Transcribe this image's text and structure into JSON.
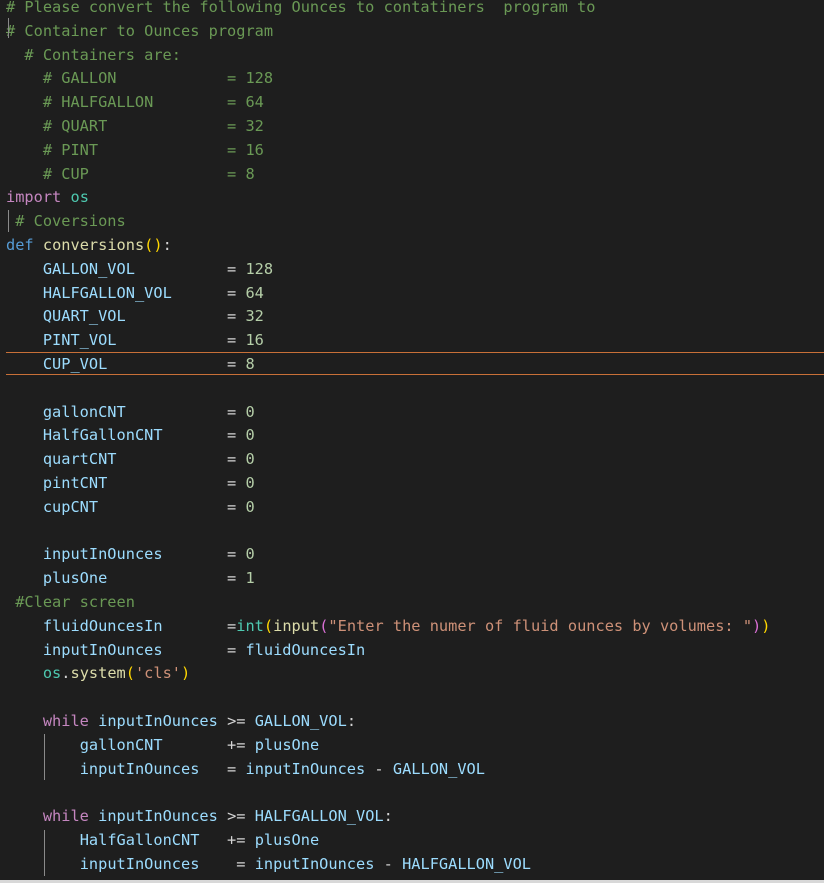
{
  "editor": {
    "lines": [
      [
        {
          "t": "# Please convert the following Ounces to contatiners  program to",
          "c": "cm"
        }
      ],
      [
        {
          "t": "# Container to Ounces program",
          "c": "cm"
        }
      ],
      [
        {
          "t": "  # Containers are:",
          "c": "cm"
        }
      ],
      [
        {
          "t": "    # GALLON            = 128",
          "c": "cm"
        }
      ],
      [
        {
          "t": "    # HALFGALLON        = 64",
          "c": "cm"
        }
      ],
      [
        {
          "t": "    # QUART             = 32",
          "c": "cm"
        }
      ],
      [
        {
          "t": "    # PINT              = 16",
          "c": "cm"
        }
      ],
      [
        {
          "t": "    # CUP               = 8",
          "c": "cm"
        }
      ],
      [
        {
          "t": "import",
          "c": "kw"
        },
        {
          "t": " ",
          "c": "op"
        },
        {
          "t": "os",
          "c": "bt"
        }
      ],
      [
        {
          "t": " # Coversions",
          "c": "cm"
        }
      ],
      [
        {
          "t": "def",
          "c": "df"
        },
        {
          "t": " ",
          "c": "op"
        },
        {
          "t": "conversions",
          "c": "fn"
        },
        {
          "t": "()",
          "c": "b1"
        },
        {
          "t": ":",
          "c": "op"
        }
      ],
      [
        {
          "t": "    ",
          "c": "op"
        },
        {
          "t": "GALLON_VOL",
          "c": "vr"
        },
        {
          "t": "          = ",
          "c": "op"
        },
        {
          "t": "128",
          "c": "nm"
        }
      ],
      [
        {
          "t": "    ",
          "c": "op"
        },
        {
          "t": "HALFGALLON_VOL",
          "c": "vr"
        },
        {
          "t": "      = ",
          "c": "op"
        },
        {
          "t": "64",
          "c": "nm"
        }
      ],
      [
        {
          "t": "    ",
          "c": "op"
        },
        {
          "t": "QUART_VOL",
          "c": "vr"
        },
        {
          "t": "           = ",
          "c": "op"
        },
        {
          "t": "32",
          "c": "nm"
        }
      ],
      [
        {
          "t": "    ",
          "c": "op"
        },
        {
          "t": "PINT_VOL",
          "c": "vr"
        },
        {
          "t": "            = ",
          "c": "op"
        },
        {
          "t": "16",
          "c": "nm"
        }
      ],
      [
        {
          "t": "    ",
          "c": "op"
        },
        {
          "t": "CUP_VOL",
          "c": "vr"
        },
        {
          "t": "             = ",
          "c": "op"
        },
        {
          "t": "8",
          "c": "nm"
        }
      ],
      [],
      [
        {
          "t": "    ",
          "c": "op"
        },
        {
          "t": "gallonCNT",
          "c": "vr"
        },
        {
          "t": "           = ",
          "c": "op"
        },
        {
          "t": "0",
          "c": "nm"
        }
      ],
      [
        {
          "t": "    ",
          "c": "op"
        },
        {
          "t": "HalfGallonCNT",
          "c": "vr"
        },
        {
          "t": "       = ",
          "c": "op"
        },
        {
          "t": "0",
          "c": "nm"
        }
      ],
      [
        {
          "t": "    ",
          "c": "op"
        },
        {
          "t": "quartCNT",
          "c": "vr"
        },
        {
          "t": "            = ",
          "c": "op"
        },
        {
          "t": "0",
          "c": "nm"
        }
      ],
      [
        {
          "t": "    ",
          "c": "op"
        },
        {
          "t": "pintCNT",
          "c": "vr"
        },
        {
          "t": "             = ",
          "c": "op"
        },
        {
          "t": "0",
          "c": "nm"
        }
      ],
      [
        {
          "t": "    ",
          "c": "op"
        },
        {
          "t": "cupCNT",
          "c": "vr"
        },
        {
          "t": "              = ",
          "c": "op"
        },
        {
          "t": "0",
          "c": "nm"
        }
      ],
      [],
      [
        {
          "t": "    ",
          "c": "op"
        },
        {
          "t": "inputInOunces",
          "c": "vr"
        },
        {
          "t": "       = ",
          "c": "op"
        },
        {
          "t": "0",
          "c": "nm"
        }
      ],
      [
        {
          "t": "    ",
          "c": "op"
        },
        {
          "t": "plusOne",
          "c": "vr"
        },
        {
          "t": "             = ",
          "c": "op"
        },
        {
          "t": "1",
          "c": "nm"
        }
      ],
      [
        {
          "t": " #Clear screen",
          "c": "cm"
        }
      ],
      [
        {
          "t": "    ",
          "c": "op"
        },
        {
          "t": "fluidOuncesIn",
          "c": "vr"
        },
        {
          "t": "       =",
          "c": "op"
        },
        {
          "t": "int",
          "c": "bt"
        },
        {
          "t": "(",
          "c": "b1"
        },
        {
          "t": "input",
          "c": "fn"
        },
        {
          "t": "(",
          "c": "b2"
        },
        {
          "t": "\"Enter the numer of fluid ounces by volumes: \"",
          "c": "st"
        },
        {
          "t": ")",
          "c": "b2"
        },
        {
          "t": ")",
          "c": "b1"
        }
      ],
      [
        {
          "t": "    ",
          "c": "op"
        },
        {
          "t": "inputInOunces",
          "c": "vr"
        },
        {
          "t": "       = ",
          "c": "op"
        },
        {
          "t": "fluidOuncesIn",
          "c": "vr"
        }
      ],
      [
        {
          "t": "    ",
          "c": "op"
        },
        {
          "t": "os",
          "c": "bt"
        },
        {
          "t": ".",
          "c": "op"
        },
        {
          "t": "system",
          "c": "fn"
        },
        {
          "t": "(",
          "c": "b1"
        },
        {
          "t": "'cls'",
          "c": "st"
        },
        {
          "t": ")",
          "c": "b1"
        }
      ],
      [],
      [
        {
          "t": "    ",
          "c": "op"
        },
        {
          "t": "while",
          "c": "kw"
        },
        {
          "t": " ",
          "c": "op"
        },
        {
          "t": "inputInOunces",
          "c": "vr"
        },
        {
          "t": " >= ",
          "c": "op"
        },
        {
          "t": "GALLON_VOL",
          "c": "vr"
        },
        {
          "t": ":",
          "c": "op"
        }
      ],
      [
        {
          "t": "        ",
          "c": "op"
        },
        {
          "t": "gallonCNT",
          "c": "vr"
        },
        {
          "t": "       += ",
          "c": "op"
        },
        {
          "t": "plusOne",
          "c": "vr"
        }
      ],
      [
        {
          "t": "        ",
          "c": "op"
        },
        {
          "t": "inputInOunces",
          "c": "vr"
        },
        {
          "t": "   = ",
          "c": "op"
        },
        {
          "t": "inputInOunces",
          "c": "vr"
        },
        {
          "t": " - ",
          "c": "op"
        },
        {
          "t": "GALLON_VOL",
          "c": "vr"
        }
      ],
      [],
      [
        {
          "t": "    ",
          "c": "op"
        },
        {
          "t": "while",
          "c": "kw"
        },
        {
          "t": " ",
          "c": "op"
        },
        {
          "t": "inputInOunces",
          "c": "vr"
        },
        {
          "t": " >= ",
          "c": "op"
        },
        {
          "t": "HALFGALLON_VOL",
          "c": "vr"
        },
        {
          "t": ":",
          "c": "op"
        }
      ],
      [
        {
          "t": "        ",
          "c": "op"
        },
        {
          "t": "HalfGallonCNT",
          "c": "vr"
        },
        {
          "t": "   += ",
          "c": "op"
        },
        {
          "t": "plusOne",
          "c": "vr"
        }
      ],
      [
        {
          "t": "        ",
          "c": "op"
        },
        {
          "t": "inputInOunces",
          "c": "vr"
        },
        {
          "t": "    = ",
          "c": "op"
        },
        {
          "t": "inputInOunces",
          "c": "vr"
        },
        {
          "t": " - ",
          "c": "op"
        },
        {
          "t": "HALFGALLON_VOL",
          "c": "vr"
        }
      ]
    ]
  },
  "colors": {
    "background": "#1e1e1e",
    "comment": "#6a9955",
    "keyword": "#c586c0",
    "def": "#569cd6",
    "function": "#dcdcaa",
    "variable": "#9cdcfe",
    "number": "#b5cea8",
    "string": "#ce9178",
    "builtin": "#4ec9b0",
    "cursor_line_border": "#c87038"
  }
}
